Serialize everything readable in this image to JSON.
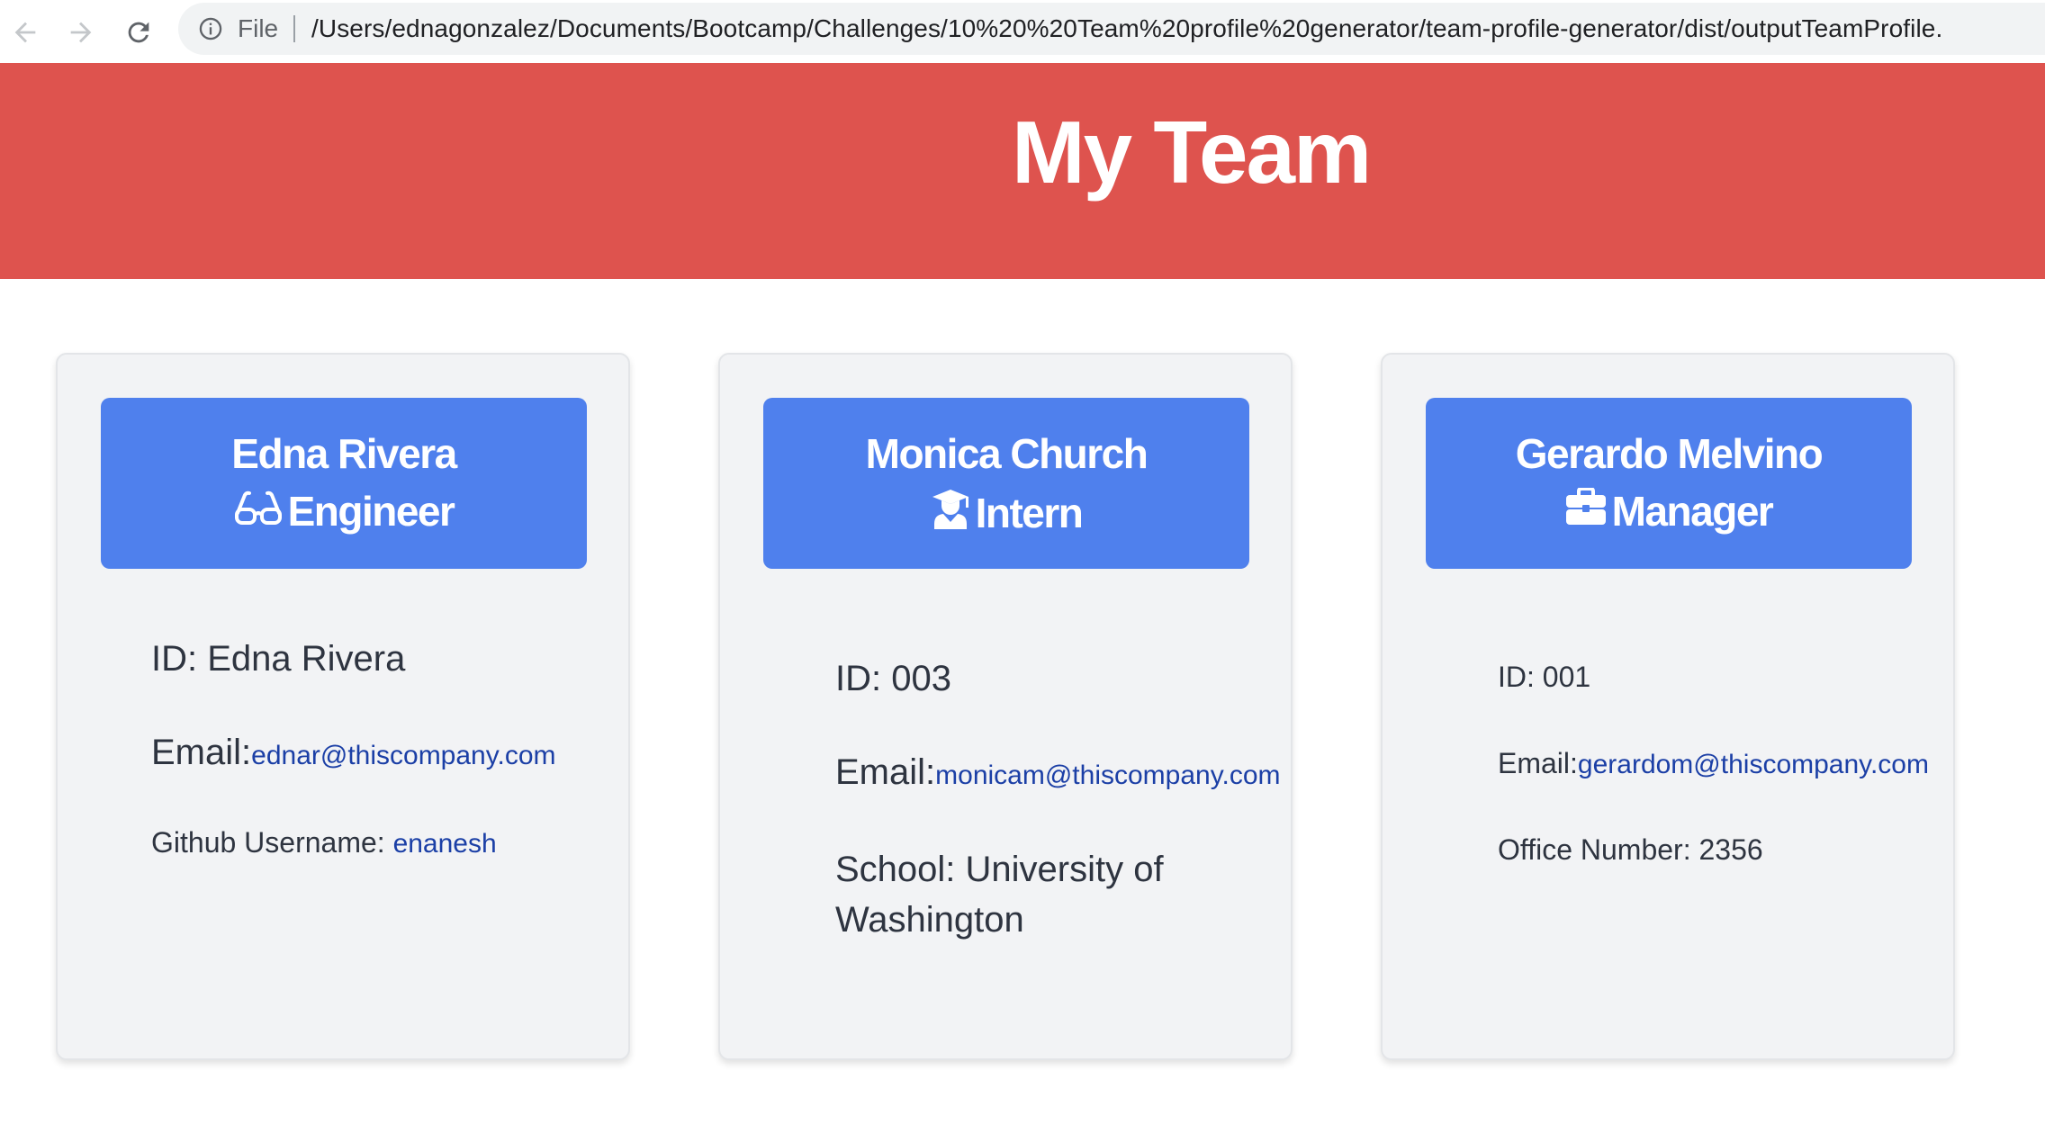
{
  "browser": {
    "file_label": "File",
    "url": "/Users/ednagonzalez/Documents/Bootcamp/Challenges/10%20%20Team%20profile%20generator/team-profile-generator/dist/outputTeamProfile."
  },
  "header": {
    "title": "My Team",
    "background_color": "#de534e"
  },
  "card_header_color": "#4f80ed",
  "team": [
    {
      "name": "Edna Rivera",
      "role": "Engineer",
      "role_icon": "glasses-icon",
      "id_label": "ID: ",
      "id": "Edna Rivera",
      "email_label": "Email:",
      "email": "ednar@thiscompany.com",
      "extra_label": "Github Username: ",
      "extra_value": "enanesh"
    },
    {
      "name": "Monica Church",
      "role": "Intern",
      "role_icon": "graduate-icon",
      "id_label": "ID: ",
      "id": "003",
      "email_label": "Email:",
      "email": "monicam@thiscompany.com",
      "extra_label": "School: ",
      "extra_value": "University of Washington"
    },
    {
      "name": "Gerardo Melvino",
      "role": "Manager",
      "role_icon": "briefcase-icon",
      "id_label": "ID: ",
      "id": "001",
      "email_label": "Email:",
      "email": "gerardom@thiscompany.com",
      "extra_label": "Office Number: ",
      "extra_value": "2356"
    }
  ]
}
